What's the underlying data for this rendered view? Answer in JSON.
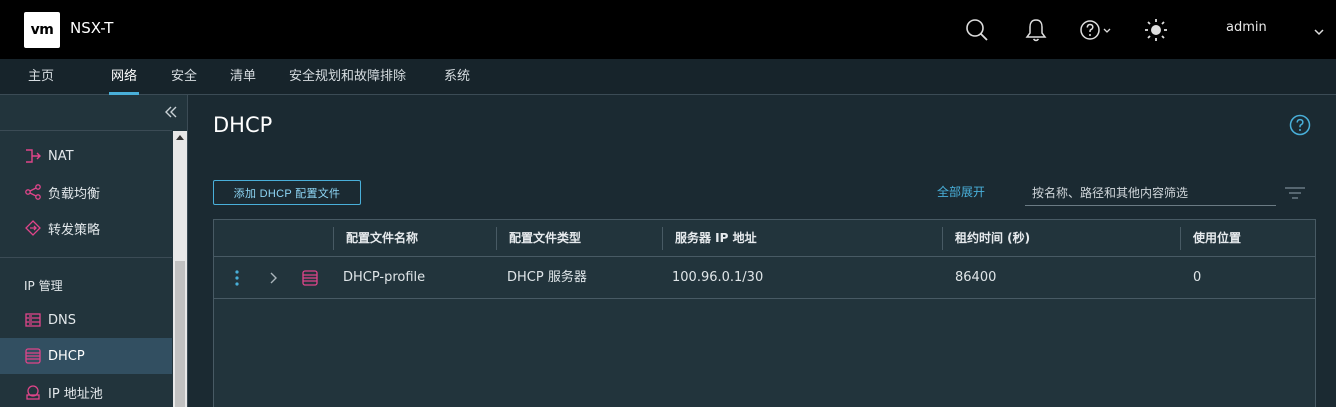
{
  "header": {
    "logo": "vm",
    "title": "NSX-T",
    "user": "admin"
  },
  "nav": {
    "tabs": [
      "主页",
      "网络",
      "安全",
      "清单",
      "安全规划和故障排除",
      "系统"
    ],
    "active": "网络"
  },
  "sidebar": {
    "items_top": [
      {
        "label": "NAT",
        "icon": "nat-icon"
      },
      {
        "label": "负载均衡",
        "icon": "load-balancer-icon"
      },
      {
        "label": "转发策略",
        "icon": "forwarding-policy-icon"
      }
    ],
    "group_label": "IP 管理",
    "items_ip": [
      {
        "label": "DNS",
        "icon": "dns-icon"
      },
      {
        "label": "DHCP",
        "icon": "dhcp-icon",
        "active": true
      },
      {
        "label": "IP 地址池",
        "icon": "ip-pool-icon"
      }
    ]
  },
  "main": {
    "title": "DHCP",
    "add_button": "添加 DHCP 配置文件",
    "expand_all": "全部展开",
    "filter_placeholder": "按名称、路径和其他内容筛选",
    "columns": [
      "配置文件名称",
      "配置文件类型",
      "服务器 IP 地址",
      "租约时间 (秒)",
      "使用位置"
    ],
    "rows": [
      {
        "name": "DHCP-profile",
        "type": "DHCP 服务器",
        "server_ip": "100.96.0.1/30",
        "lease": "86400",
        "used_in": "0"
      }
    ]
  },
  "colors": {
    "accent": "#49afd9",
    "sidebar_active": "#324f61",
    "icon_pink": "#e0458a"
  }
}
